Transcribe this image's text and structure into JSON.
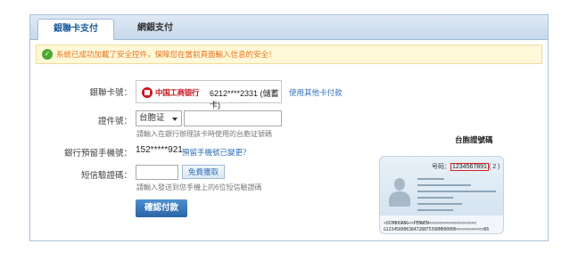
{
  "tabs": [
    {
      "label": "銀聯卡支付"
    },
    {
      "label": "網銀支付"
    }
  ],
  "notice": {
    "text": "系統已成功加載了安全控件，保障您在當前頁面輸入信息的安全！"
  },
  "card": {
    "label": "銀聯卡號：",
    "bank_name": "中国工商银行",
    "number": "6212****2331 (儲蓄卡)",
    "other_card_link": "使用其他卡付款"
  },
  "id": {
    "label": "證件號：",
    "type_selected": "台胞证",
    "value": "",
    "hint": "請輸入在銀行辦理該卡時使用的台胞证號碼"
  },
  "phone": {
    "label": "銀行預留手機號：",
    "value": "152*****921",
    "change_link": "預留手機號已變更？"
  },
  "sms": {
    "label": "短信驗證碼：",
    "value": "",
    "button": "免費獲取",
    "hint": "請輸入發送到您手機上的6位短信驗證碼"
  },
  "submit": {
    "label": "確認付款"
  },
  "sample": {
    "caption": "台胞證號碼",
    "number_prefix": "号码：",
    "number": "1234567891",
    "number_suffix": "( 2 )",
    "mrz_line1": "<OCHNHUANG<<PENWEN<<<<<<<<<<<<<<<<<<<",
    "mrz_line2": "G123458906384728875398M000000<<<<<<<<<<<66"
  },
  "colors": {
    "accent": "#2f6fb7",
    "notice_text": "#e8731f",
    "bank_red": "#c8161d",
    "submit": "#2a64a6"
  },
  "icons": [
    "check-circle-icon",
    "icbc-logo-icon",
    "dropdown-arrow-icon",
    "person-silhouette-icon"
  ]
}
